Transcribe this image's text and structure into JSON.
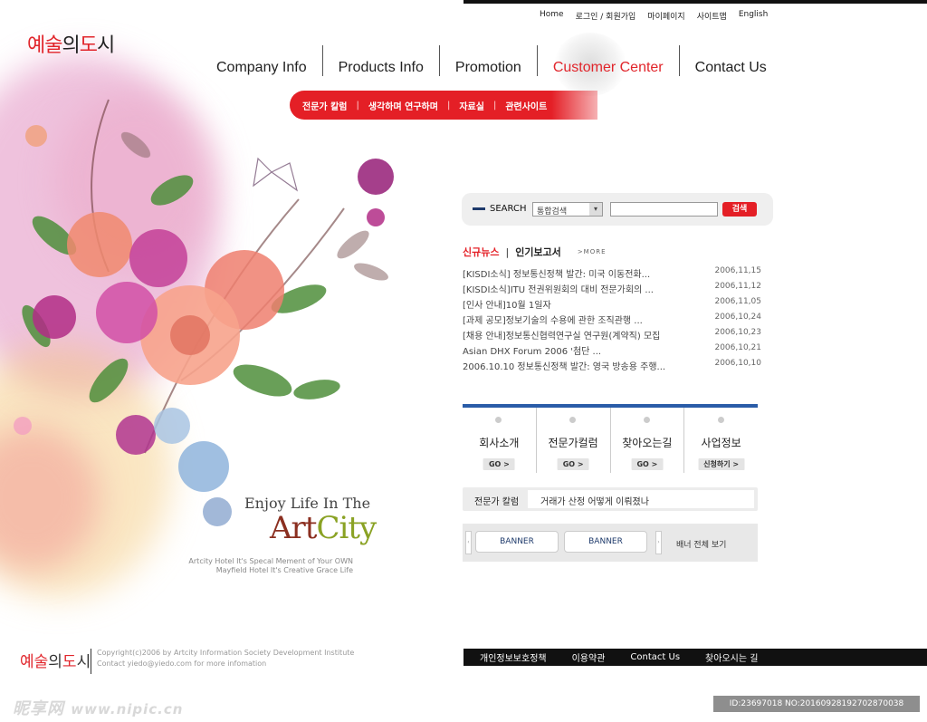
{
  "brand": {
    "logo_part1": "예술",
    "logo_part2": "의",
    "logo_part3": "도",
    "logo_part4": "시"
  },
  "top_links": [
    "Home",
    "로그인 / 회원가입",
    "마이페이지",
    "사이트맵",
    "English"
  ],
  "nav": [
    "Company Info",
    "Products Info",
    "Promotion",
    "Customer Center",
    "Contact Us"
  ],
  "nav_active": "Customer Center",
  "subnav": [
    "전문가 칼럼",
    "생각하며 연구하며",
    "자료실",
    "관련사이트"
  ],
  "subnav_sep": "|",
  "art": {
    "enjoy": "Enjoy Life In The",
    "art_part1": "Art",
    "art_part2": "City",
    "tagline1": "Artcity  Hotel It's Specal Mement of Your OWN",
    "tagline2": "Mayfield Hotel It's Creative Grace Life"
  },
  "search": {
    "label": "SEARCH",
    "select_value": "통합검색",
    "select_arrow": "▾",
    "input_value": "",
    "button": "검색"
  },
  "news": {
    "tab_active": "신규뉴스",
    "tab_sep": "|",
    "tab_other": "인기보고서",
    "more": ">MORE",
    "items": [
      {
        "title": "[KISDI소식] 정보통신정책 발간: 미국 이동전화...",
        "date": "2006,11,15"
      },
      {
        "title": "[KISDI소식]ITU 전권위원회의 대비 전문가회의 ...",
        "date": "2006,11,12"
      },
      {
        "title": "[인사 안내]10월 1일자",
        "date": "2006,11,05"
      },
      {
        "title": "[과제 공모]정보기술의 수용에 관한 조직관행  ...",
        "date": "2006,10,24"
      },
      {
        "title": "[채용 안내]정보통신협력연구실 연구원(계약직) 모집",
        "date": "2006,10,23"
      },
      {
        "title": "Asian DHX Forum 2006 '첨단 ...",
        "date": "2006,10,21"
      },
      {
        "title": "2006.10.10 정보통신정책 발간: 영국 방송용 주행...",
        "date": "2006,10,10"
      }
    ]
  },
  "tiles": [
    {
      "name": "회사소개",
      "go": "GO >"
    },
    {
      "name": "전문가컬럼",
      "go": "GO >"
    },
    {
      "name": "찾아오는길",
      "go": "GO >"
    },
    {
      "name": "사업정보",
      "go": "신청하기 >"
    }
  ],
  "column": {
    "label": "전문가 칼럼",
    "text": "거래가 산정 어떻게 이뤄졌나"
  },
  "banners": {
    "items": [
      "BANNER",
      "BANNER"
    ],
    "view_all": "배너 전체 보기",
    "arrow_left": "‹",
    "arrow_right": "›"
  },
  "footer": {
    "logo_part1": "예술",
    "logo_part2": "의",
    "logo_part3": "도",
    "logo_part4": "시",
    "copy1": "Copyright(c)2006 by Artcity Information Society Development Institute",
    "copy2": "Contact yiedo@yiedo.com for more infomation",
    "links": [
      "개인정보보호정책",
      "이용약관",
      "Contact Us",
      "찾아오시는 길"
    ]
  },
  "watermark": {
    "left_text": "昵享网",
    "left_url": "www.nipic.cn",
    "right_text": "ID:23697018 NO:20160928192702870038"
  },
  "colors": {
    "accent_red": "#e41f26",
    "nav_blue": "#2a5ca8",
    "footer_black": "#111111"
  }
}
